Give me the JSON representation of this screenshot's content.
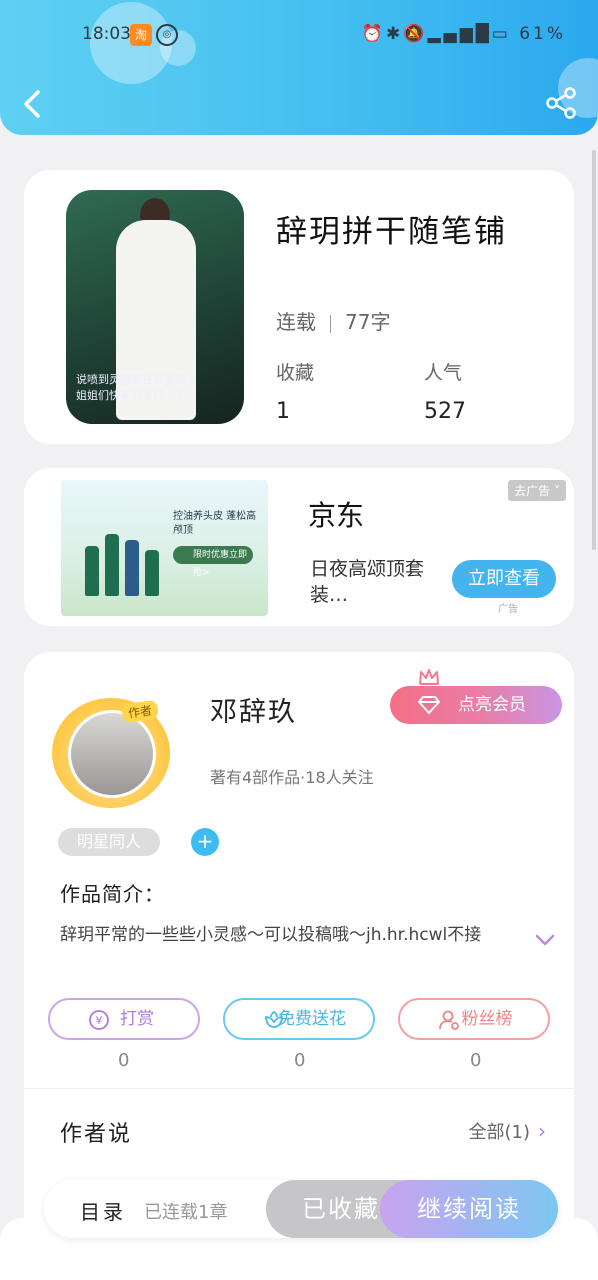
{
  "status_bar": {
    "time": "18:03",
    "app1": "淘",
    "app2": "◎",
    "battery": "61%"
  },
  "book": {
    "title": "辞玥拼干随笔铺",
    "status": "连载",
    "word_count": "77字",
    "collect_label": "收藏",
    "collect_value": "1",
    "popularity_label": "人气",
    "popularity_value": "527",
    "cover_caption": "说喷到灵感都在这里啦~\n姐姐们快来们支持一下~"
  },
  "ad": {
    "brand": "京东",
    "description": "日夜高颂顶套装…",
    "close_label": "去广告 ˅",
    "view_label": "立即查看",
    "tag": "广告",
    "img_headline": "控油养头皮 蓬松高颅顶",
    "img_banner": "限时优惠立即抢>"
  },
  "author": {
    "badge": "作者",
    "name": "邓辞玖",
    "vip_label": "点亮会员",
    "meta": "著有4部作品·18人关注",
    "tag": "明星同人",
    "intro_title": "作品简介：",
    "intro_text": "辞玥平常的一些些小灵感～可以投稿哦～jh.hr.hcwl不接",
    "actions": [
      {
        "label": "打赏",
        "count": "0"
      },
      {
        "label": "免费送花",
        "count": "0"
      },
      {
        "label": "粉丝榜",
        "count": "0"
      }
    ],
    "say_title": "作者说",
    "say_all": "全部(1)"
  },
  "bottom": {
    "toc_label": "目录",
    "toc_count": "已连载1章",
    "collected_label": "已收藏",
    "read_label": "继续阅读"
  },
  "colors": {
    "header": "#45bff0",
    "accent_blue": "#44b4ef",
    "vip_pink": "#f46f86",
    "reward_purple": "#b07ae0",
    "flower_teal": "#43b9e6",
    "fans_red": "#ef8585"
  }
}
